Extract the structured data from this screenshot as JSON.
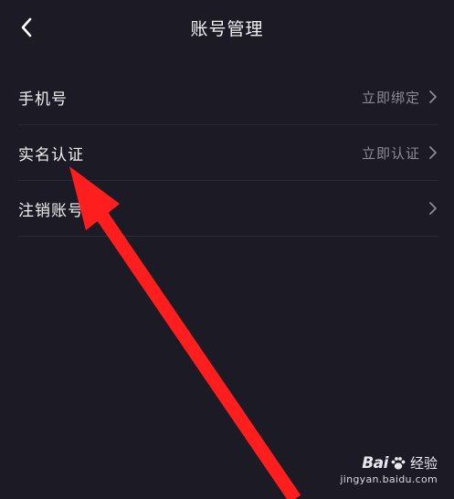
{
  "header": {
    "title": "账号管理",
    "back_icon": "chevron-left-icon"
  },
  "rows": [
    {
      "label": "手机号",
      "value": "立即绑定"
    },
    {
      "label": "实名认证",
      "value": "立即认证"
    },
    {
      "label": "注销账号",
      "value": ""
    }
  ],
  "watermark": {
    "brand_prefix": "Bai",
    "brand_suffix": "经验",
    "url": "jingyan.baidu.com"
  },
  "colors": {
    "background": "#1c1b25",
    "annotation_arrow": "#ff1e1e",
    "secondary_text": "#8c8b94"
  }
}
